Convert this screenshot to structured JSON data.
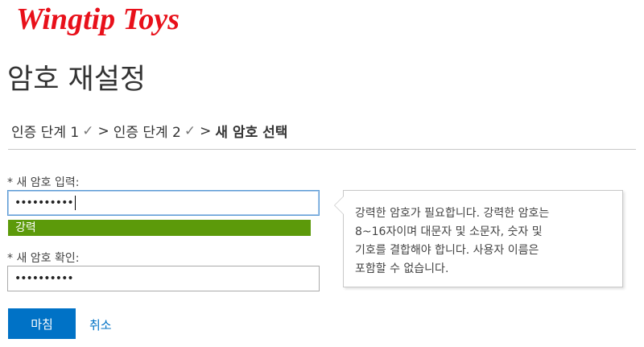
{
  "brand": {
    "logo_text": "Wingtip Toys",
    "logo_color": "#e8101a"
  },
  "header": {
    "title": "암호 재설정"
  },
  "breadcrumb": {
    "step1": "인증 단계 1",
    "step2": "인증 단계 2",
    "current": "새 암호 선택",
    "check_glyph": "✓",
    "separator": ">"
  },
  "form": {
    "new_password": {
      "label": "* 새 암호 입력:",
      "value": "••••••••••",
      "strength_text": "강력",
      "strength_color": "#5c9a0a"
    },
    "confirm_password": {
      "label": "* 새 암호 확인:",
      "value": "••••••••••"
    },
    "submit_label": "마침",
    "cancel_label": "취소"
  },
  "tooltip": {
    "lines": [
      "강력한 암호가 필요합니다. 강력한 암호는",
      "8~16자이며 대문자 및 소문자, 숫자 및",
      "기호를 결합해야 합니다. 사용자 이름은",
      "포함할 수 없습니다."
    ]
  },
  "colors": {
    "accent": "#0072c6",
    "focus_border": "#5b9bd5"
  }
}
